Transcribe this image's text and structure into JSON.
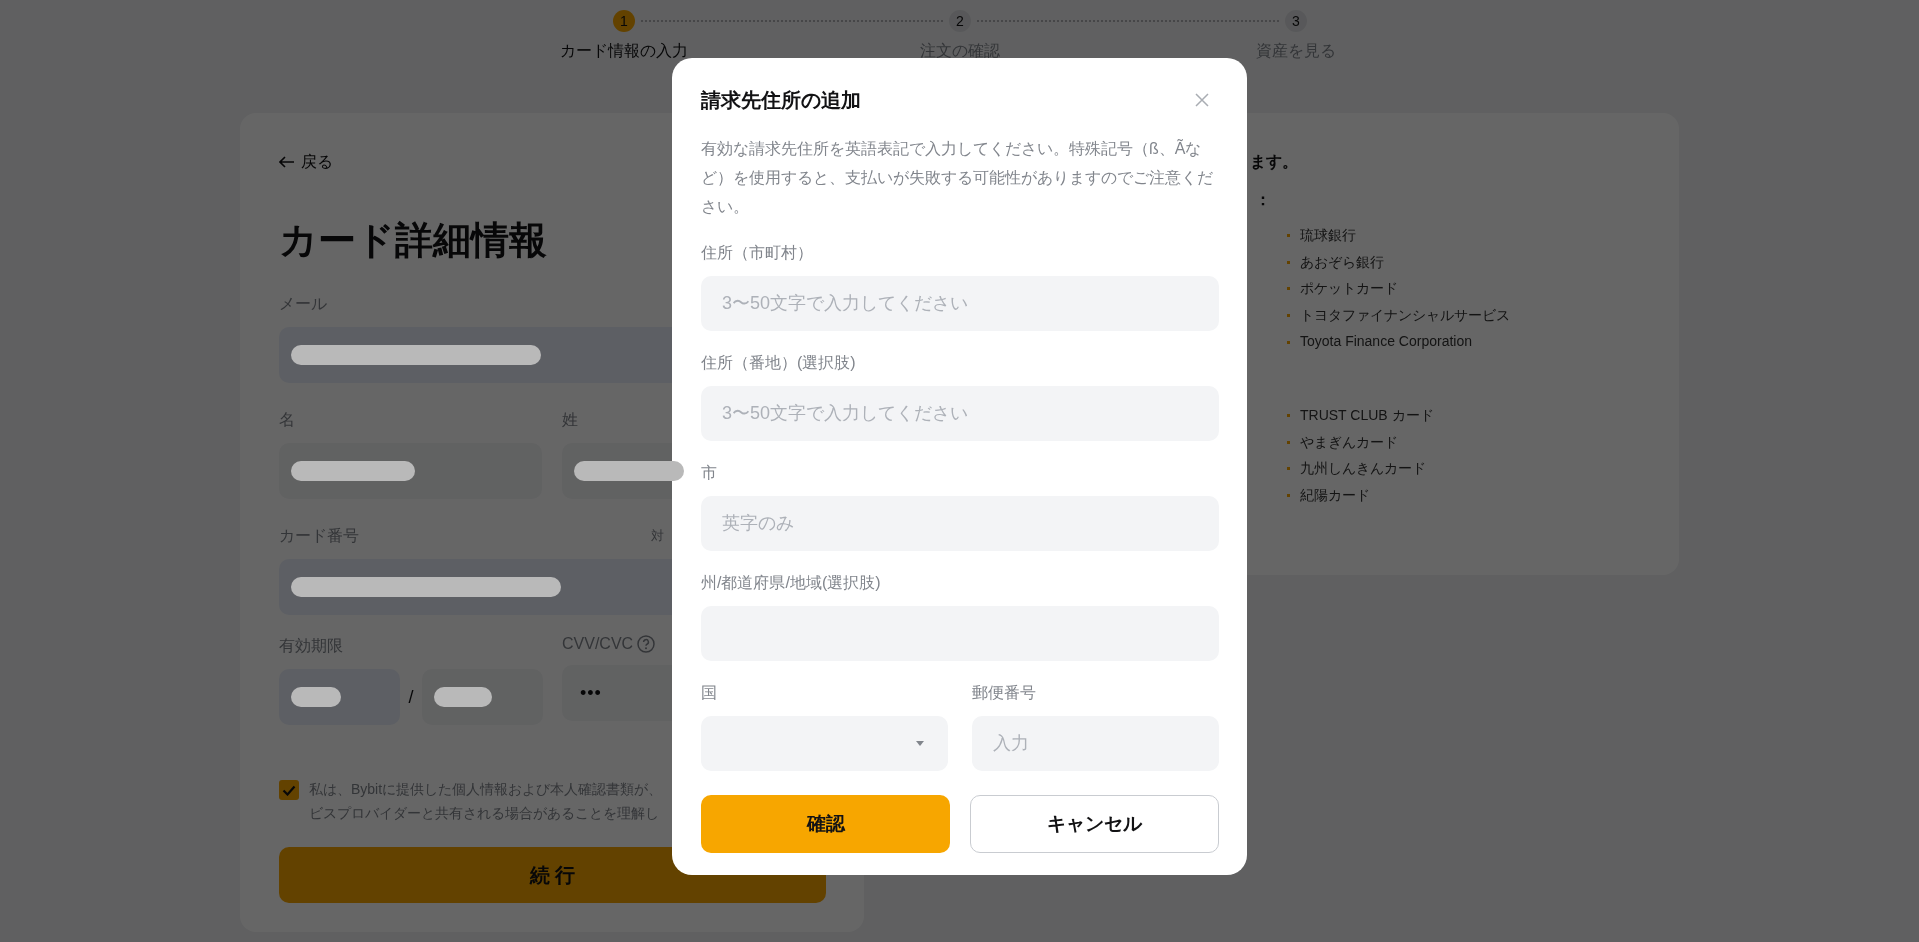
{
  "stepper": [
    {
      "number": "1",
      "label": "カード情報の入力",
      "selected": true
    },
    {
      "number": "2",
      "label": "注文の確認",
      "selected": false
    },
    {
      "number": "3",
      "label": "資産を見る",
      "selected": false
    }
  ],
  "card_form": {
    "back": "戻る",
    "title": "カード詳細情報",
    "email_label": "メール",
    "first_name_label": "名",
    "last_name_label": "姓",
    "card_number_label": "カード番号",
    "card_number_note": "対",
    "expiry_label": "有効期限",
    "expiry_separator": "/",
    "cvv_label": "CVV/CVC",
    "cvv_value": "•••",
    "consent": {
      "checked": true,
      "lines": [
        "私は、Bybitに提供した個人情報および本人確認書類が、",
        "ビスプロバイダーと共有される場合があることを理解し"
      ]
    },
    "continue_button": "続 行"
  },
  "supported_cards": {
    "heading": "ます。",
    "subheading": "：",
    "groups": [
      [
        "琉球銀行",
        "あおぞら銀行",
        "ポケットカード",
        "トヨタファイナンシャルサービス",
        "Toyota Finance Corporation"
      ],
      [
        "TRUST CLUB カード",
        "やまぎんカード",
        "九州しんきんカード",
        "紀陽カード"
      ]
    ]
  },
  "dialog": {
    "title": "請求先住所の追加",
    "description": "有効な請求先住所を英語表記で入力してください。特殊記号（ß、Ãなど）を使用すると、支払いが失敗する可能性がありますのでご注意ください。",
    "rows": [
      [
        {
          "kind": "input",
          "label": "住所（市町村）",
          "placeholder": "3〜50文字で入力してください"
        }
      ],
      [
        {
          "kind": "input",
          "label": "住所（番地）(選択肢)",
          "placeholder": "3〜50文字で入力してください"
        }
      ],
      [
        {
          "kind": "input",
          "label": "市",
          "placeholder": "英字のみ"
        }
      ],
      [
        {
          "kind": "input",
          "label": "州/都道府県/地域(選択肢)"
        }
      ],
      [
        {
          "kind": "select",
          "label": "国"
        },
        {
          "kind": "input",
          "label": "郵便番号",
          "placeholder": "入力"
        }
      ]
    ],
    "buttons": [
      {
        "kind": "primary",
        "label": "確認"
      },
      {
        "kind": "secondary",
        "label": "キャンセル"
      }
    ]
  }
}
